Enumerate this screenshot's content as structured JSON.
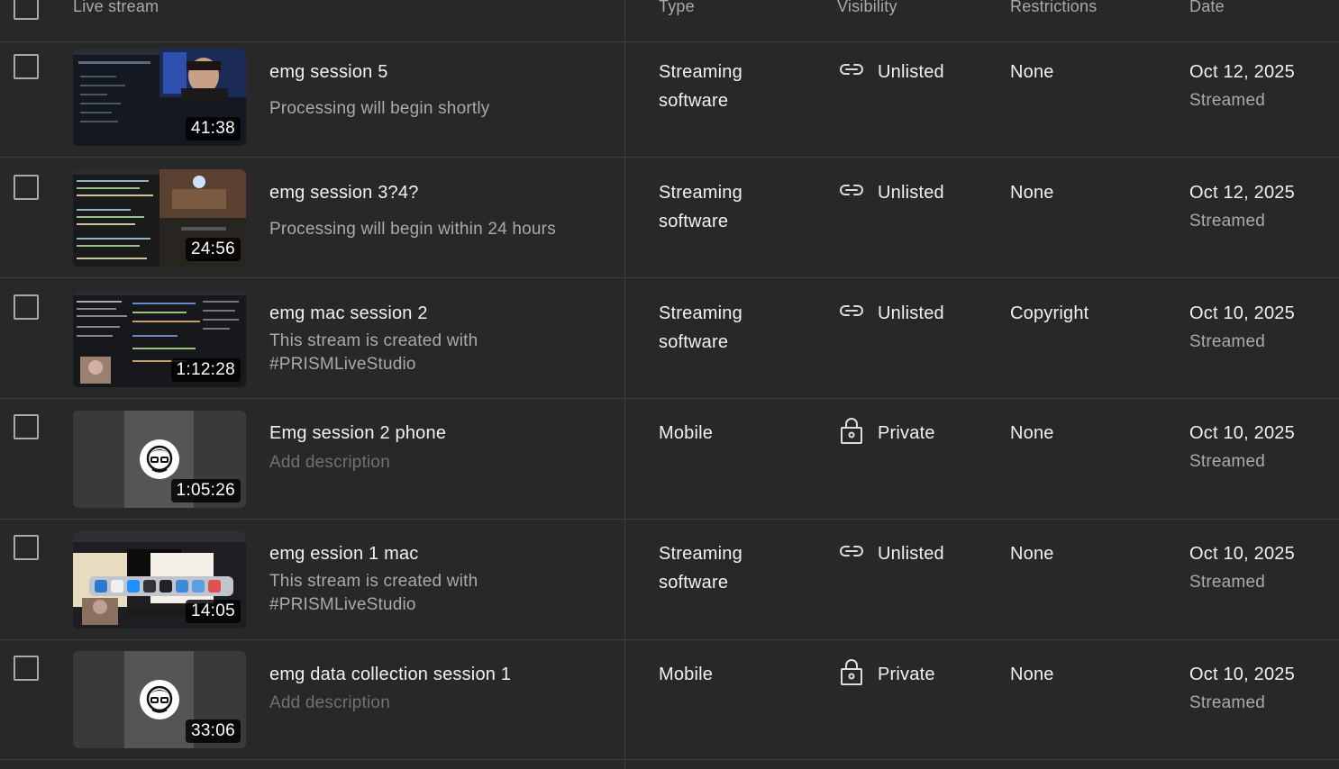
{
  "header": {
    "live_stream": "Live stream",
    "type": "Type",
    "visibility": "Visibility",
    "restrictions": "Restrictions",
    "date": "Date"
  },
  "rows": [
    {
      "title": "emg session 5",
      "description": "Processing will begin shortly",
      "duration": "41:38",
      "type": "Streaming software",
      "visibility": "Unlisted",
      "visibility_icon": "link-icon",
      "restrictions": "None",
      "date": "Oct 12, 2025",
      "status": "Streamed"
    },
    {
      "title": "emg session 3?4?",
      "description": "Processing will begin within 24 hours",
      "duration": "24:56",
      "type": "Streaming software",
      "visibility": "Unlisted",
      "visibility_icon": "link-icon",
      "restrictions": "None",
      "date": "Oct 12, 2025",
      "status": "Streamed"
    },
    {
      "title": "emg mac session 2",
      "description": "This stream is created with #PRISMLiveStudio",
      "duration": "1:12:28",
      "type": "Streaming software",
      "visibility": "Unlisted",
      "visibility_icon": "link-icon",
      "restrictions": "Copyright",
      "date": "Oct 10, 2025",
      "status": "Streamed"
    },
    {
      "title": "Emg session 2 phone",
      "description": "Add description",
      "duration": "1:05:26",
      "type": "Mobile",
      "visibility": "Private",
      "visibility_icon": "lock-icon",
      "restrictions": "None",
      "date": "Oct 10, 2025",
      "status": "Streamed"
    },
    {
      "title": "emg ession 1 mac",
      "description": "This stream is created with #PRISMLiveStudio",
      "duration": "14:05",
      "type": "Streaming software",
      "visibility": "Unlisted",
      "visibility_icon": "link-icon",
      "restrictions": "None",
      "date": "Oct 10, 2025",
      "status": "Streamed"
    },
    {
      "title": "emg data collection session 1",
      "description": "Add description",
      "duration": "33:06",
      "type": "Mobile",
      "visibility": "Private",
      "visibility_icon": "lock-icon",
      "restrictions": "None",
      "date": "Oct 10, 2025",
      "status": "Streamed"
    }
  ]
}
